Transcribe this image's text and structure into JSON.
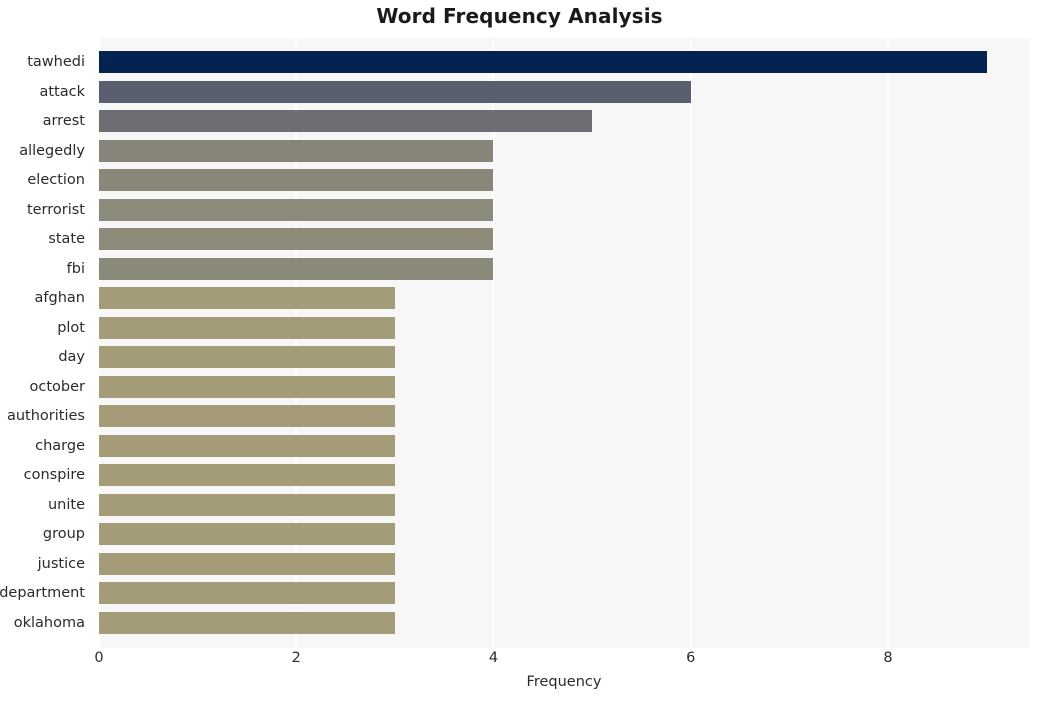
{
  "chart_data": {
    "type": "bar",
    "orientation": "horizontal",
    "title": "Word Frequency Analysis",
    "xlabel": "Frequency",
    "ylabel": "",
    "xlim": [
      0,
      9.43
    ],
    "xticks": [
      0,
      2,
      4,
      6,
      8
    ],
    "xtick_labels": [
      "0",
      "2",
      "4",
      "6",
      "8"
    ],
    "grid": "vertical-only",
    "legend": "none",
    "plot_background": "#f7f7f7",
    "figure_background": "#ffffff",
    "categories": [
      "tawhedi",
      "attack",
      "arrest",
      "allegedly",
      "election",
      "terrorist",
      "state",
      "fbi",
      "afghan",
      "plot",
      "day",
      "october",
      "authorities",
      "charge",
      "conspire",
      "unite",
      "group",
      "justice",
      "department",
      "oklahoma"
    ],
    "values": [
      9,
      6,
      5,
      4,
      4,
      4,
      4,
      4,
      3,
      3,
      3,
      3,
      3,
      3,
      3,
      3,
      3,
      3,
      3,
      3
    ],
    "bar_colors": [
      "#042351",
      "#5a5f70",
      "#6c6e74",
      "#87857a",
      "#8a8779",
      "#8c8a7b",
      "#8d8a7a",
      "#8b897a",
      "#a49c78",
      "#a49c78",
      "#a49c78",
      "#a49c78",
      "#a49c78",
      "#a49c78",
      "#a49c78",
      "#a49c78",
      "#a49c78",
      "#a49c78",
      "#a49c78",
      "#a49c78"
    ],
    "accent_color": "#042351",
    "gridline_color": "#ffffff",
    "text_color": "#2b2b2b"
  }
}
